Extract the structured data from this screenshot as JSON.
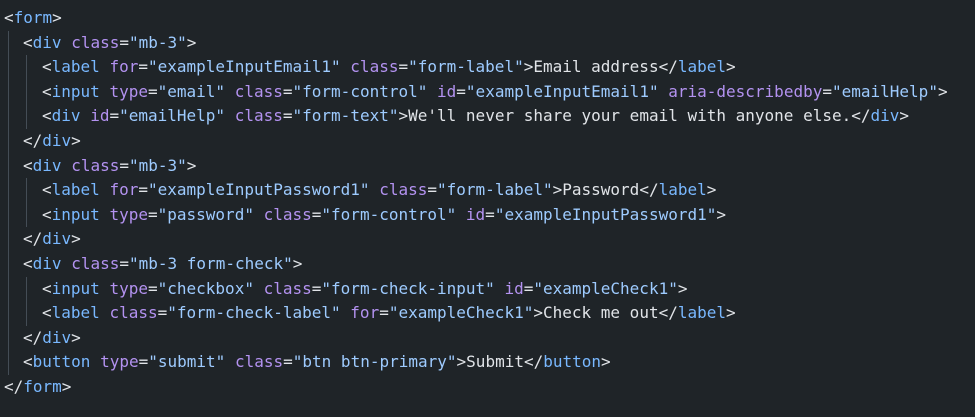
{
  "colors": {
    "background": "#1f2428",
    "tag": "#79b8ff",
    "attribute": "#b392f0",
    "string": "#9ecbff",
    "text": "#e1e4e8",
    "indent_guide": "#444d56"
  },
  "code": {
    "l1": {
      "tag": "form"
    },
    "l2": {
      "tag": "div",
      "a1": "class",
      "v1": "\"mb-3\""
    },
    "l3": {
      "tag": "label",
      "a1": "for",
      "v1": "\"exampleInputEmail1\"",
      "a2": "class",
      "v2": "\"form-label\"",
      "text": "Email address",
      "close": "label"
    },
    "l4": {
      "tag": "input",
      "a1": "type",
      "v1": "\"email\"",
      "a2": "class",
      "v2": "\"form-control\"",
      "a3": "id",
      "v3": "\"exampleInputEmail1\"",
      "a4": "aria-describedby",
      "v4": "\"emailHelp\""
    },
    "l5": {
      "tag": "div",
      "a1": "id",
      "v1": "\"emailHelp\"",
      "a2": "class",
      "v2": "\"form-text\"",
      "text": "We'll never share your email with anyone else.",
      "close": "div"
    },
    "l6": {
      "close": "div"
    },
    "l7": {
      "tag": "div",
      "a1": "class",
      "v1": "\"mb-3\""
    },
    "l8": {
      "tag": "label",
      "a1": "for",
      "v1": "\"exampleInputPassword1\"",
      "a2": "class",
      "v2": "\"form-label\"",
      "text": "Password",
      "close": "label"
    },
    "l9": {
      "tag": "input",
      "a1": "type",
      "v1": "\"password\"",
      "a2": "class",
      "v2": "\"form-control\"",
      "a3": "id",
      "v3": "\"exampleInputPassword1\""
    },
    "l10": {
      "close": "div"
    },
    "l11": {
      "tag": "div",
      "a1": "class",
      "v1": "\"mb-3 form-check\""
    },
    "l12": {
      "tag": "input",
      "a1": "type",
      "v1": "\"checkbox\"",
      "a2": "class",
      "v2": "\"form-check-input\"",
      "a3": "id",
      "v3": "\"exampleCheck1\""
    },
    "l13": {
      "tag": "label",
      "a1": "class",
      "v1": "\"form-check-label\"",
      "a2": "for",
      "v2": "\"exampleCheck1\"",
      "text": "Check me out",
      "close": "label"
    },
    "l14": {
      "close": "div"
    },
    "l15": {
      "tag": "button",
      "a1": "type",
      "v1": "\"submit\"",
      "a2": "class",
      "v2": "\"btn btn-primary\"",
      "text": "Submit",
      "close": "button"
    },
    "l16": {
      "close": "form"
    }
  }
}
